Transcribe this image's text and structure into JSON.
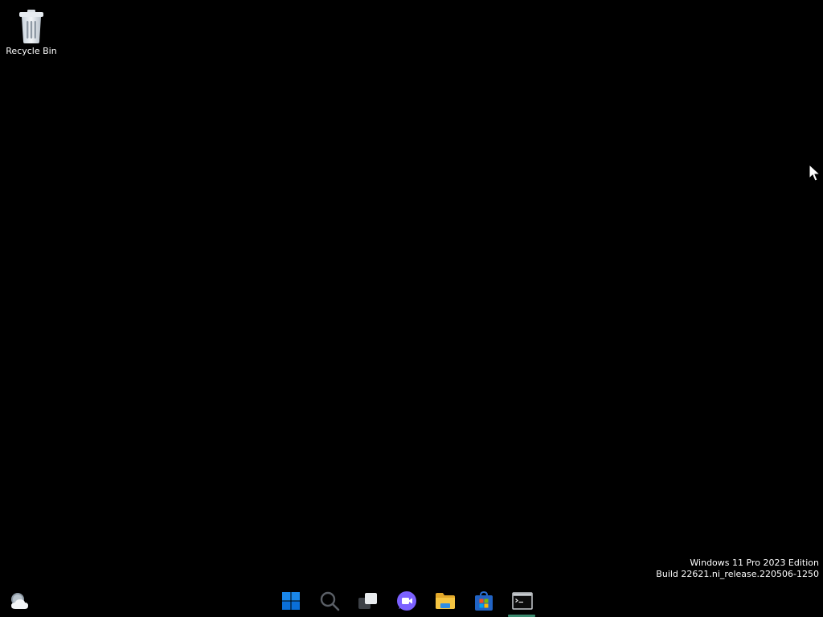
{
  "desktop": {
    "icons": [
      {
        "label": "Recycle Bin",
        "icon": "recycle-bin-icon"
      }
    ]
  },
  "watermark": {
    "line1": "Windows 11 Pro 2023 Edition",
    "line2": "Build 22621.ni_release.220506-1250"
  },
  "taskbar": {
    "widgets_icon": "weather-icon",
    "items": [
      {
        "icon": "windows-start-icon"
      },
      {
        "icon": "search-icon"
      },
      {
        "icon": "task-view-icon"
      },
      {
        "icon": "teams-chat-icon"
      },
      {
        "icon": "file-explorer-icon"
      },
      {
        "icon": "microsoft-store-icon"
      },
      {
        "icon": "terminal-icon",
        "running": true
      }
    ]
  },
  "colors": {
    "background": "#000000",
    "start_blue": "#0a6fd8",
    "teams_purple": "#7b61ff",
    "folder_yellow": "#f5c542",
    "running_indicator": "#3a8a6e"
  }
}
